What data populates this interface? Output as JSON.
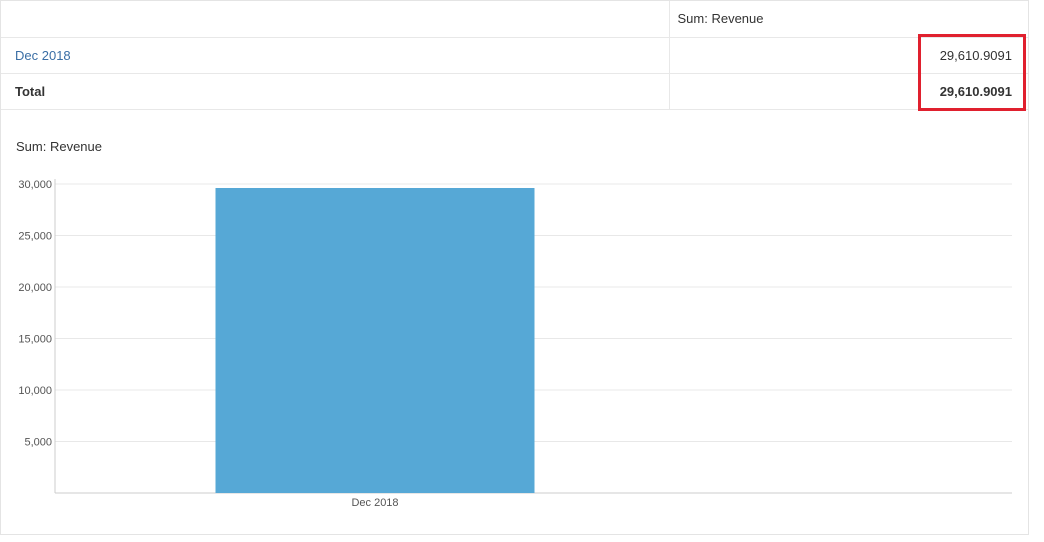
{
  "pivot": {
    "header": {
      "row_label": "",
      "value_label": "Sum: Revenue"
    },
    "rows": [
      {
        "label": "Dec 2018",
        "value": "29,610.9091"
      }
    ],
    "total": {
      "label": "Total",
      "value": "29,610.9091"
    }
  },
  "colors": {
    "bar": "#56a8d6",
    "highlight": "#e0202e",
    "link": "#3a6ea5",
    "grid": "#e8e8e8"
  },
  "chart_data": {
    "type": "bar",
    "title": "Sum: Revenue",
    "categories": [
      "Dec 2018"
    ],
    "series": [
      {
        "values": [
          29610.9091
        ]
      }
    ],
    "ylim": [
      0,
      30000
    ],
    "yticks": [
      5000,
      10000,
      15000,
      20000,
      25000,
      30000
    ],
    "ytick_labels": [
      "5,000",
      "10,000",
      "15,000",
      "20,000",
      "25,000",
      "30,000"
    ],
    "xlabel": "",
    "ylabel": "",
    "grid": true,
    "legend": "none"
  }
}
